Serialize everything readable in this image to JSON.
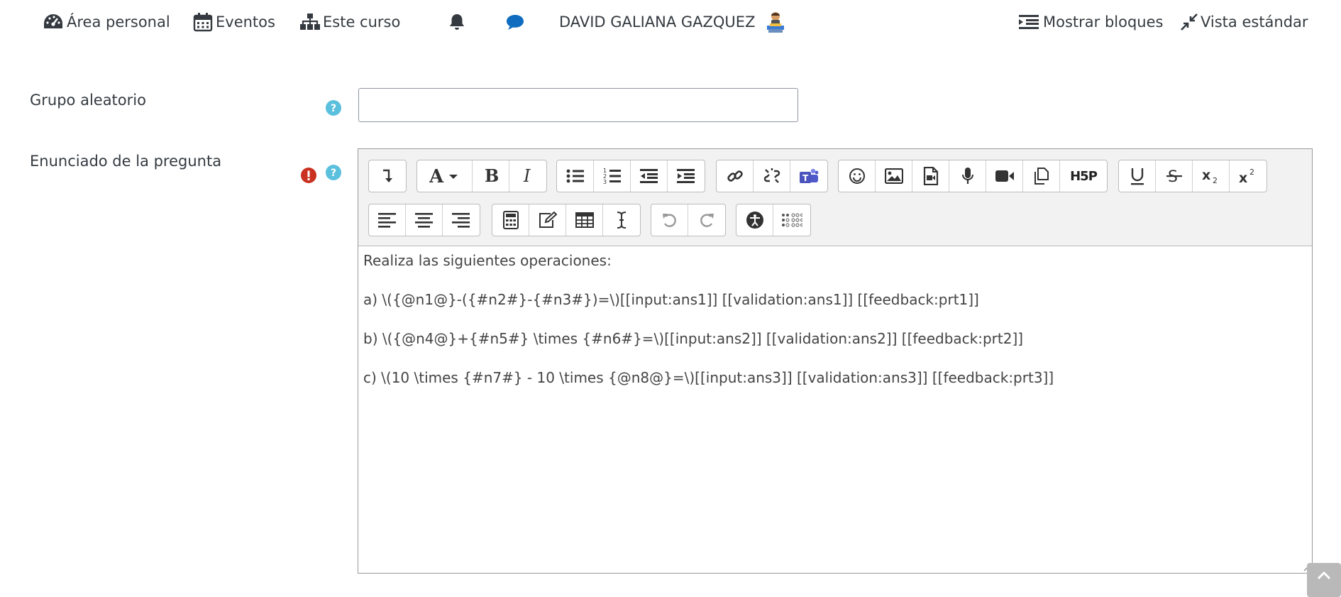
{
  "navbar": {
    "items": [
      {
        "label": "Área personal",
        "icon": "dashboard-icon"
      },
      {
        "label": "Eventos",
        "icon": "calendar-icon"
      },
      {
        "label": "Este curso",
        "icon": "sitemap-icon"
      }
    ],
    "notifications_icon": "bell-icon",
    "messages_icon": "chat-icon",
    "user_name": "DAVID GALIANA GAZQUEZ",
    "show_blocks": "Mostrar bloques",
    "standard_view": "Vista estándar"
  },
  "form": {
    "random_group_label": "Grupo aleatorio",
    "random_group_value": "",
    "question_text_label": "Enunciado de la pregunta"
  },
  "editor": {
    "toolbar_buttons": [
      [
        "collapse-icon"
      ],
      [
        "font-style-icon",
        "bold-icon",
        "italic-icon"
      ],
      [
        "unordered-list-icon",
        "ordered-list-icon",
        "outdent-icon",
        "indent-icon"
      ],
      [
        "link-icon",
        "unlink-icon",
        "teams-icon"
      ],
      [
        "emoji-icon",
        "image-icon",
        "media-icon",
        "record-audio-icon",
        "record-video-icon",
        "manage-files-icon",
        "h5p-icon"
      ],
      [
        "underline-icon",
        "strikethrough-icon",
        "subscript-icon",
        "superscript-icon"
      ],
      [
        "align-left-icon",
        "align-center-icon",
        "align-right-icon"
      ],
      [
        "equation-icon",
        "edit-icon",
        "table-icon",
        "text-cursor-icon"
      ],
      [
        "undo-icon",
        "redo-icon"
      ],
      [
        "accessibility-checker-icon",
        "screenreader-helper-icon"
      ]
    ],
    "h5p_text": "H5P",
    "lines": [
      "Realiza las siguientes operaciones:",
      "a) \\({@n1@}-({#n2#}-{#n3#})=\\)[[input:ans1]] [[validation:ans1]] [[feedback:prt1]]",
      "b) \\({@n4@}+{#n5#} \\times {#n6#}=\\)[[input:ans2]] [[validation:ans2]] [[feedback:prt2]]",
      "c) \\(10 \\times {#n7#} - 10 \\times {@n8@}=\\)[[input:ans3]] [[validation:ans3]] [[feedback:prt3]]"
    ]
  },
  "colors": {
    "help": "#5bc0de",
    "required": "#ca3120",
    "text": "#343a40"
  }
}
